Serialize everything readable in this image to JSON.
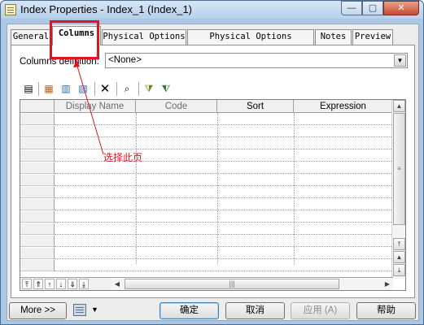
{
  "window": {
    "title": "Index Properties - Index_1 (Index_1)",
    "controls": {
      "minimize": "—",
      "maximize": "▢",
      "close": "✕"
    }
  },
  "tabs": [
    {
      "label": "General",
      "active": false
    },
    {
      "label": "Columns",
      "active": true
    },
    {
      "label": "Physical Options",
      "active": false
    },
    {
      "label": "Physical Options (Common)",
      "active": false
    },
    {
      "label": "Notes",
      "active": false
    },
    {
      "label": "Preview",
      "active": false
    }
  ],
  "columns_tab": {
    "definition_label": "Columns definition:",
    "definition_value": "<None>"
  },
  "toolbar": {
    "icons": [
      "properties-icon",
      "add-columns-icon",
      "insert-row-icon",
      "add-row-icon",
      "delete-icon",
      "find-icon",
      "filter-icon",
      "clear-filter-icon"
    ]
  },
  "grid": {
    "headers": [
      "Display Name",
      "Code",
      "Sort",
      "Expression"
    ],
    "row_count": 13
  },
  "annotation": {
    "text": "选择此页",
    "color": "#e0141e"
  },
  "buttons": {
    "more": "More >>",
    "ok": "确定",
    "cancel": "取消",
    "apply": "应用 (A)",
    "help": "帮助"
  }
}
